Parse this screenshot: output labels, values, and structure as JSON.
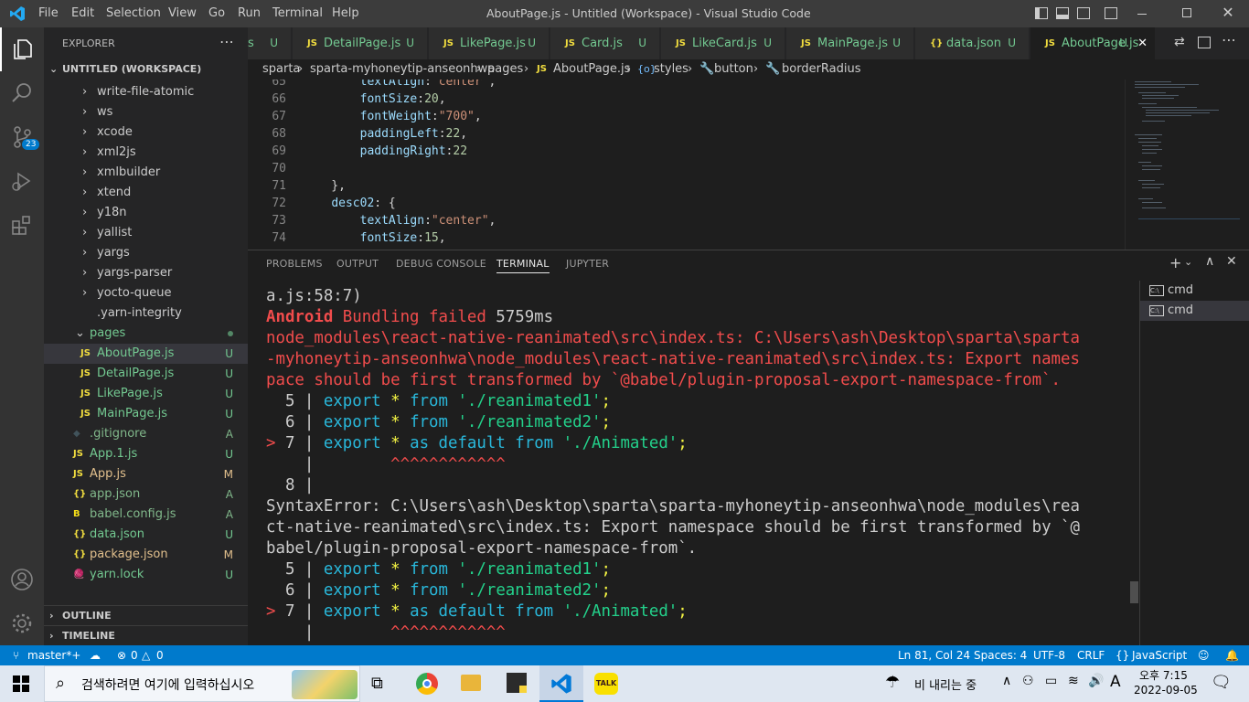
{
  "titlebar": {
    "menus": [
      "File",
      "Edit",
      "Selection",
      "View",
      "Go",
      "Run",
      "Terminal",
      "Help"
    ],
    "title": "AboutPage.js - Untitled (Workspace) - Visual Studio Code"
  },
  "activity": {
    "scm_badge": "23"
  },
  "sidebar": {
    "header": "EXPLORER",
    "workspace": "UNTITLED (WORKSPACE)",
    "folders": [
      "write-file-atomic",
      "ws",
      "xcode",
      "xml2js",
      "xmlbuilder",
      "xtend",
      "y18n",
      "yallist",
      "yargs",
      "yargs-parser",
      "yocto-queue"
    ],
    "yarn_integrity": ".yarn-integrity",
    "pages_folder": "pages",
    "pages_files": [
      {
        "name": "AboutPage.js",
        "status": "U"
      },
      {
        "name": "DetailPage.js",
        "status": "U"
      },
      {
        "name": "LikePage.js",
        "status": "U"
      },
      {
        "name": "MainPage.js",
        "status": "U"
      }
    ],
    "root_files": [
      {
        "name": ".gitignore",
        "status": "A",
        "icon": "◆"
      },
      {
        "name": "App.1.js",
        "status": "U",
        "icon": "JS"
      },
      {
        "name": "App.js",
        "status": "M",
        "icon": "JS"
      },
      {
        "name": "app.json",
        "status": "A",
        "icon": "{}"
      },
      {
        "name": "babel.config.js",
        "status": "A",
        "icon": "B"
      },
      {
        "name": "data.json",
        "status": "U",
        "icon": "{}"
      },
      {
        "name": "package.json",
        "status": "M",
        "icon": "{}"
      },
      {
        "name": "yarn.lock",
        "status": "U",
        "icon": "🧶"
      }
    ],
    "outline": "OUTLINE",
    "timeline": "TIMELINE"
  },
  "tabs": [
    {
      "name": "s",
      "status": "U",
      "icon": ""
    },
    {
      "name": "DetailPage.js",
      "status": "U",
      "icon": "JS"
    },
    {
      "name": "LikePage.js",
      "status": "U",
      "icon": "JS"
    },
    {
      "name": "Card.js",
      "status": "U",
      "icon": "JS"
    },
    {
      "name": "LikeCard.js",
      "status": "U",
      "icon": "JS"
    },
    {
      "name": "MainPage.js",
      "status": "U",
      "icon": "JS"
    },
    {
      "name": "data.json",
      "status": "U",
      "icon": "{}"
    },
    {
      "name": "AboutPage.js",
      "status": "U",
      "icon": "JS"
    }
  ],
  "breadcrumb": [
    "sparta",
    "sparta-myhoneytip-anseonhwa",
    "pages",
    "AboutPage.js",
    "styles",
    "button",
    "borderRadius"
  ],
  "editor": {
    "lines": [
      {
        "n": "65",
        "t": "        textAlign:\"center\","
      },
      {
        "n": "66",
        "t": "        fontSize:20,"
      },
      {
        "n": "67",
        "t": "        fontWeight:\"700\","
      },
      {
        "n": "68",
        "t": "        paddingLeft:22,"
      },
      {
        "n": "69",
        "t": "        paddingRight:22"
      },
      {
        "n": "70",
        "t": ""
      },
      {
        "n": "71",
        "t": "    },"
      },
      {
        "n": "72",
        "t": "    desc02: {"
      },
      {
        "n": "73",
        "t": "        textAlign:\"center\","
      },
      {
        "n": "74",
        "t": "        fontSize:15,"
      }
    ]
  },
  "panel": {
    "tabs": [
      "PROBLEMS",
      "OUTPUT",
      "DEBUG CONSOLE",
      "TERMINAL",
      "JUPYTER"
    ],
    "active": "TERMINAL",
    "terminals": [
      "cmd",
      "cmd"
    ]
  },
  "terminal": {
    "l1": "a.js:58:7)",
    "l2a": "Android",
    "l2b": " Bundling failed ",
    "l2c": "5759ms",
    "l3": "node_modules\\react-native-reanimated\\src\\index.ts: C:\\Users\\ash\\Desktop\\sparta\\sparta",
    "l4": "-myhoneytip-anseonhwa\\node_modules\\react-native-reanimated\\src\\index.ts: Export names",
    "l5": "pace should be first transformed by `@babel/plugin-proposal-export-namespace-from`.",
    "c5": "export * from './reanimated1';",
    "c6": "export * from './reanimated2';",
    "c7": "export * as default from './Animated';",
    "caret": "^^^^^^^^^^^^",
    "s1": "SyntaxError: C:\\Users\\ash\\Desktop\\sparta\\sparta-myhoneytip-anseonhwa\\node_modules\\rea",
    "s2": "ct-native-reanimated\\src\\index.ts: Export namespace should be first transformed by `@",
    "s3": "babel/plugin-proposal-export-namespace-from`."
  },
  "status": {
    "branch": "master*+",
    "errors": "0",
    "warnings": "0",
    "position": "Ln 81, Col 24",
    "spaces": "Spaces: 4",
    "encoding": "UTF-8",
    "eol": "CRLF",
    "language": "JavaScript"
  },
  "taskbar": {
    "search_placeholder": "검색하려면 여기에 입력하십시오",
    "weather": "비 내리는 중",
    "ime": "A",
    "time": "오후 7:15",
    "date": "2022-09-05",
    "talk": "TALK"
  }
}
